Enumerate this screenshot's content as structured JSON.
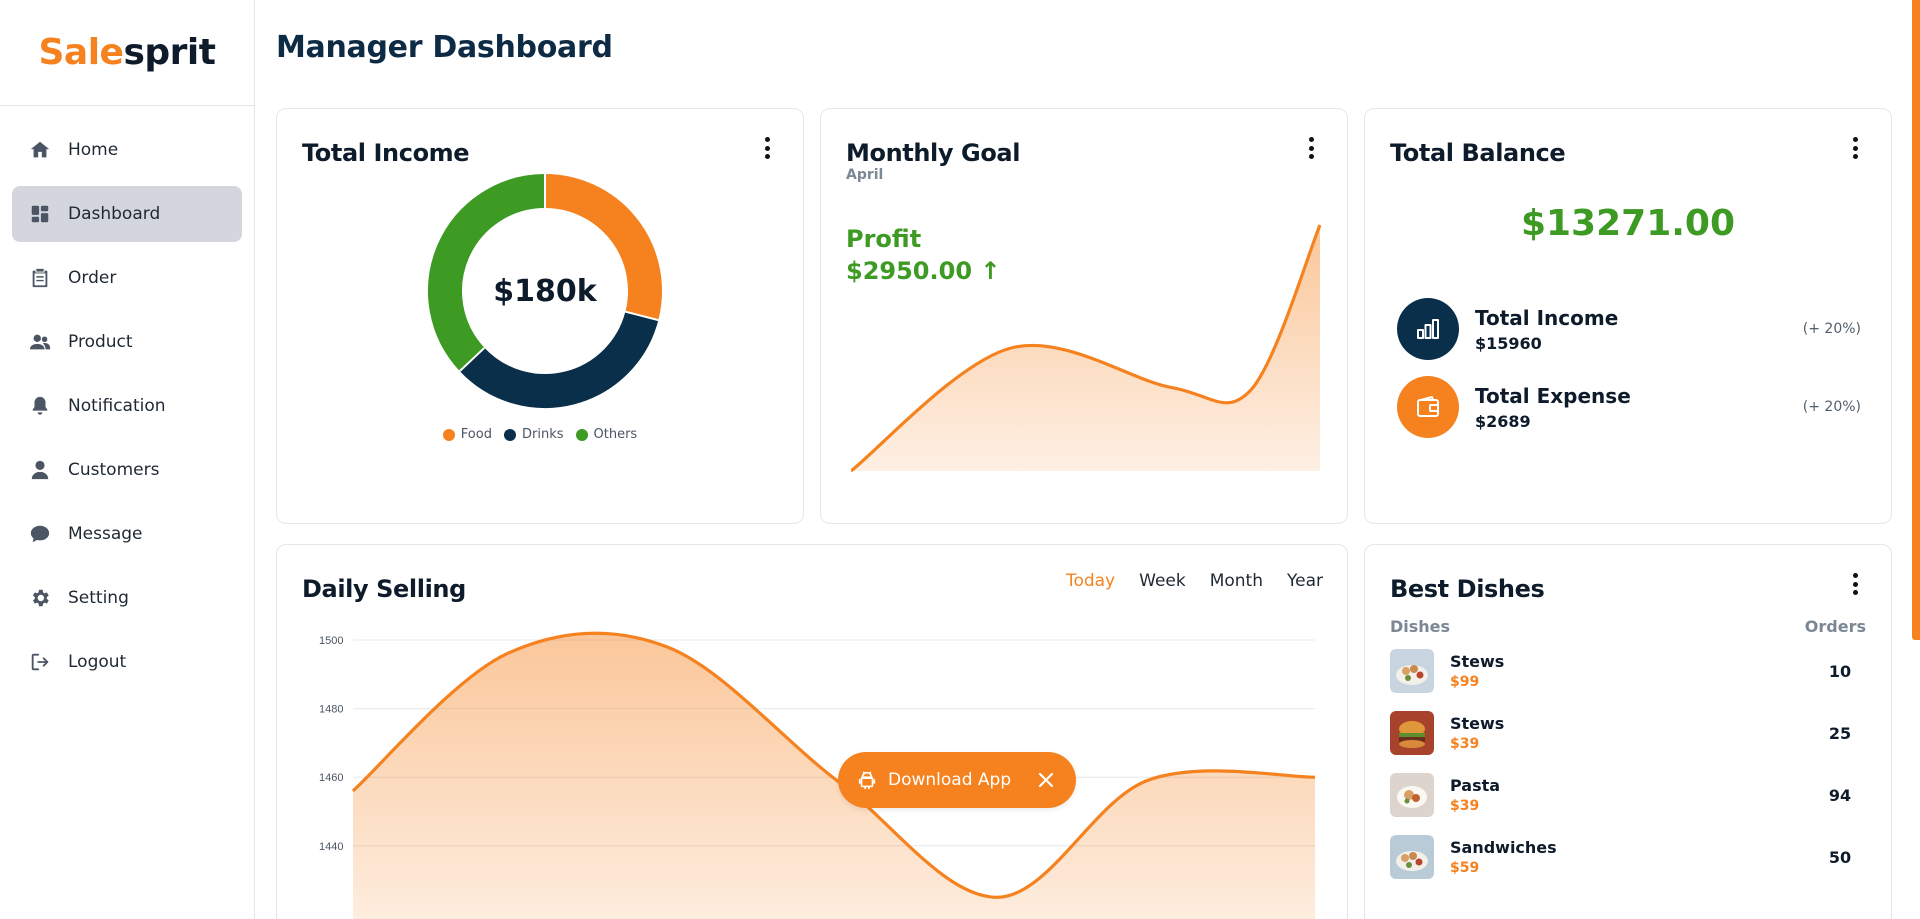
{
  "brand": {
    "part1": "Sale",
    "part2": "sprit"
  },
  "sidebar": {
    "items": [
      {
        "label": "Home",
        "icon": "home-icon"
      },
      {
        "label": "Dashboard",
        "icon": "dashboard-icon",
        "active": true
      },
      {
        "label": "Order",
        "icon": "clipboard-icon"
      },
      {
        "label": "Product",
        "icon": "users-icon"
      },
      {
        "label": "Notification",
        "icon": "bell-icon"
      },
      {
        "label": "Customers",
        "icon": "user-icon"
      },
      {
        "label": "Message",
        "icon": "chat-bubble-icon"
      },
      {
        "label": "Setting",
        "icon": "gear-icon"
      },
      {
        "label": "Logout",
        "icon": "logout-icon"
      }
    ]
  },
  "header": {
    "title": "Manager Dashboard"
  },
  "colors": {
    "accent": "#f5821f",
    "navy": "#0a2f4a",
    "green": "#3d9a23"
  },
  "income": {
    "title": "Total Income",
    "center": "$180k",
    "chart_data": {
      "type": "pie",
      "categories": [
        "Food",
        "Drinks",
        "Others"
      ],
      "values": [
        29,
        34,
        37
      ],
      "colors": [
        "#f5821f",
        "#0a2f4a",
        "#3d9a23"
      ]
    }
  },
  "goal": {
    "title": "Monthly Goal",
    "subtitle": "April",
    "profit_label": "Profit",
    "profit_value": "$2950.00 ↑",
    "chart_data": {
      "type": "area",
      "x": [
        0,
        1,
        2,
        3,
        4
      ],
      "values": [
        0,
        50,
        34,
        33,
        100
      ],
      "ylim": [
        0,
        100
      ]
    }
  },
  "balance": {
    "title": "Total Balance",
    "amount": "$13271.00",
    "income": {
      "label": "Total Income",
      "value": "$15960",
      "pct": "(+ 20%)",
      "icon": "bar-chart-icon"
    },
    "expense": {
      "label": "Total Expense",
      "value": "$2689",
      "pct": "(+ 20%)",
      "icon": "wallet-icon"
    }
  },
  "daily": {
    "title": "Daily Selling",
    "tabs": [
      "Today",
      "Week",
      "Month",
      "Year"
    ],
    "active_tab": "Today",
    "chart_data": {
      "type": "area",
      "x": [
        0,
        1,
        2,
        3,
        4,
        5,
        6
      ],
      "values": [
        1456,
        1496,
        1498,
        1459,
        1425,
        1459,
        1460
      ],
      "yticks": [
        "1500",
        "1480",
        "1460",
        "1440"
      ],
      "ylim": [
        1420,
        1503
      ]
    }
  },
  "dishes": {
    "title": "Best Dishes",
    "col_dish": "Dishes",
    "col_orders": "Orders",
    "rows": [
      {
        "name": "Stews",
        "price": "$99",
        "orders": "10",
        "thumb": "#c8d5e0"
      },
      {
        "name": "Stews",
        "price": "$39",
        "orders": "25",
        "thumb": "#c65b3a"
      },
      {
        "name": "Pasta",
        "price": "$39",
        "orders": "94",
        "thumb": "#dcd3cc"
      },
      {
        "name": "Sandwiches",
        "price": "$59",
        "orders": "50",
        "thumb": "#b8cbd6"
      }
    ]
  },
  "download": {
    "label": "Download App"
  }
}
